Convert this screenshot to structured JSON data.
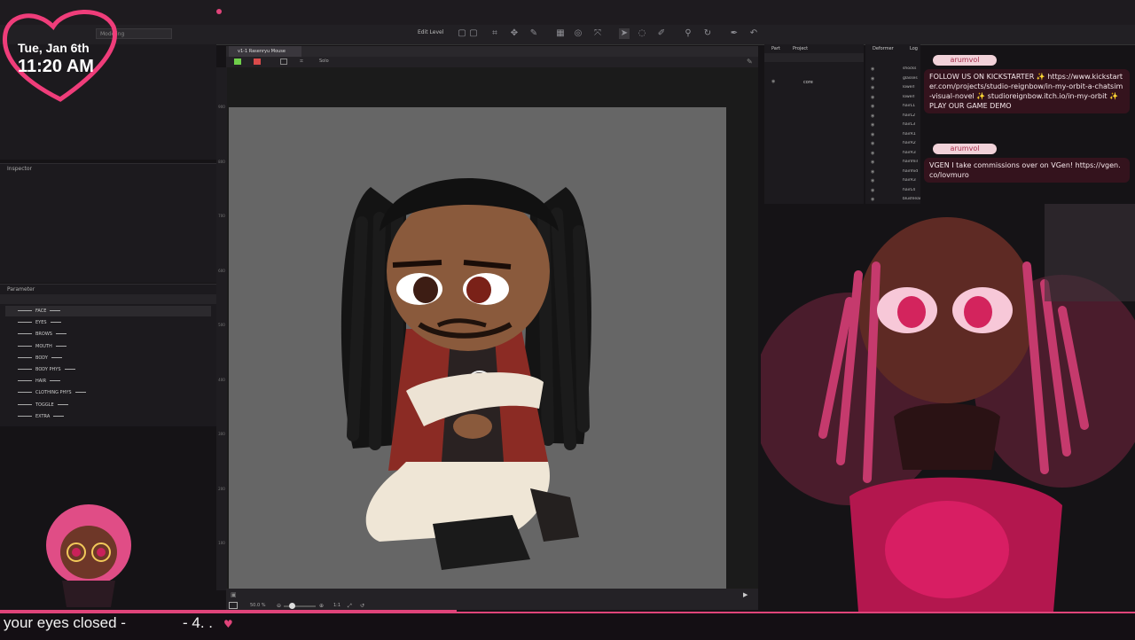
{
  "overlay": {
    "date": "Tue, Jan 6th",
    "time": "11:20 AM",
    "ticker_text": "your eyes closed -",
    "ticker_num": "- 4. ."
  },
  "app": {
    "mode_dropdown": "Modeling",
    "edit_level_label": "Edit Level",
    "file_tab": "v1-1 Rasenryu Mouse",
    "solo_label": "Solo",
    "zoom": "50.0 %",
    "ratio": "1:1"
  },
  "panels": {
    "inspector_title": "Inspector",
    "parameter_title": "Parameter",
    "part_tab": "Part",
    "project_tab": "Project",
    "deformer_tab": "Deformer",
    "log_tab": "Log",
    "part_item": "core"
  },
  "parameters": [
    {
      "label": "FACE"
    },
    {
      "label": "EYES"
    },
    {
      "label": "BROWS"
    },
    {
      "label": "MOUTH"
    },
    {
      "label": "BODY"
    },
    {
      "label": "BODY PHYS"
    },
    {
      "label": "HAIR"
    },
    {
      "label": "CLOTHING PHYS"
    },
    {
      "label": "TOGGLE"
    },
    {
      "label": "EXTRA"
    }
  ],
  "ruler_ticks": [
    "900",
    "800",
    "700",
    "600",
    "500",
    "400",
    "300",
    "200",
    "100"
  ],
  "deformer_layers": [
    "shocks",
    "glasses",
    "lowerl",
    "lowerl",
    "hairL1",
    "hairL2",
    "hairL3",
    "hairR1",
    "hairR2",
    "hairR3",
    "hairlmil",
    "hairmid",
    "hairR3",
    "hairL4",
    "blushleart"
  ],
  "chat": [
    {
      "name": "arumvol",
      "message": "FOLLOW US ON KICKSTARTER ✨ https://www.kickstarter.com/projects/studio-reignbow/in-my-orbit-a-chatsim-visual-novel ✨ studioreignbow.itch.io/in-my-orbit ✨ PLAY OUR GAME DEMO"
    },
    {
      "name": "arumvol",
      "message": "VGEN I take commissions over on VGen! https://vgen.co/lovmuro"
    }
  ],
  "colors": {
    "accent_pink": "#e0447a",
    "canvas_gray": "#666666",
    "chat_bubble": "#f1d2d9"
  }
}
